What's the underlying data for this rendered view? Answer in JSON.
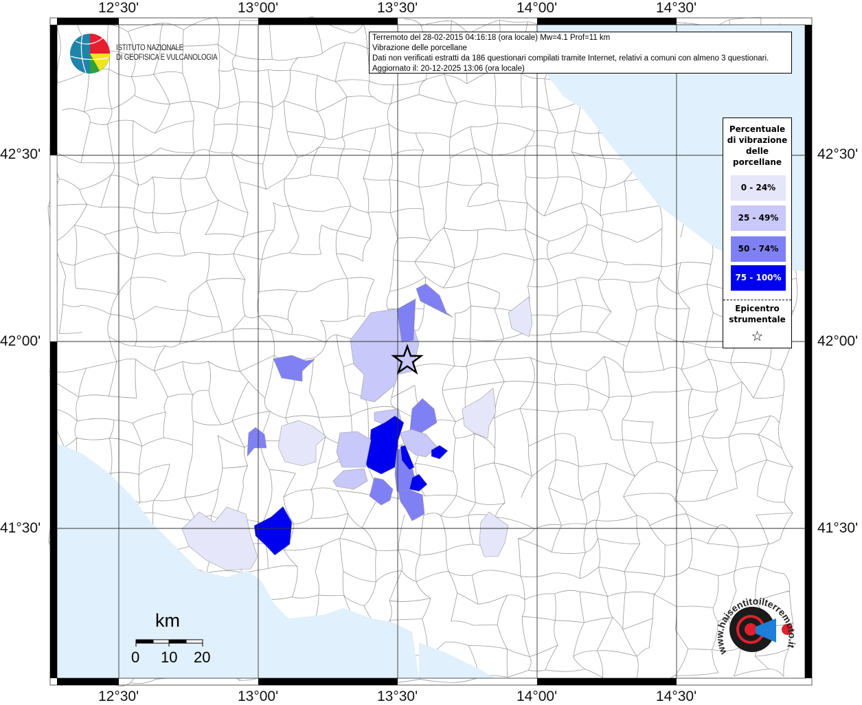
{
  "info_box": {
    "line1": "Terremoto del 28-02-2015 04:16:18 (ora locale) Mw=4.1 Prof=11 km",
    "line2": "Vibrazione delle porcellane",
    "line3": "Dati non verificati estratti da 186 questionari compilati tramite Internet, relativi a comuni con almeno 3 questionari.",
    "line4": "Aggiornato il: 20-12-2025 13:06 (ora locale)"
  },
  "logo_ingv": {
    "line1": "ISTITUTO NAZIONALE",
    "line2": "DI GEOFISICA E VULCANOLOGIA"
  },
  "logo_hsit": "www.haisentitoilterremoto.it",
  "axes": {
    "lon_ticks": [
      "12°30'",
      "13°00'",
      "13°30'",
      "14°00'",
      "14°30'"
    ],
    "lat_ticks": [
      "42°30'",
      "42°00'",
      "41°30'"
    ]
  },
  "legend": {
    "title_lines": [
      "Percentuale",
      "di vibrazione",
      "delle",
      "porcellane"
    ],
    "classes": [
      {
        "label": "0 - 24%",
        "color": "#e6e6fa"
      },
      {
        "label": "25 - 49%",
        "color": "#c8c8fa"
      },
      {
        "label": "50 - 74%",
        "color": "#8080f5"
      },
      {
        "label": "75 - 100%",
        "color": "#0000f0"
      }
    ],
    "epicenter_lines": [
      "Epicentro",
      "strumentale"
    ],
    "epicenter_symbol": "☆"
  },
  "scale_bar": {
    "unit": "km",
    "labels": [
      "0",
      "10",
      "20"
    ]
  },
  "colors": {
    "sea": "#e0f0fc",
    "land": "#ffffff",
    "borders": "#9a9a9a"
  }
}
